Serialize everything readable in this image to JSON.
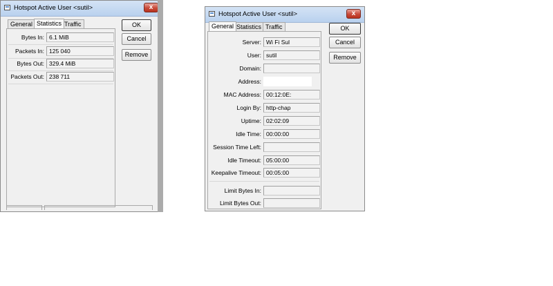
{
  "window_stats": {
    "title": "Hotspot Active User <sutil>",
    "close_label": "x",
    "tabs": [
      {
        "label": "General",
        "active": false
      },
      {
        "label": "Statistics",
        "active": true
      },
      {
        "label": "Traffic",
        "active": false
      }
    ],
    "fields": [
      {
        "label": "Bytes In:",
        "value": "6.1 MiB"
      },
      {
        "label": "Packets In:",
        "value": "125 040"
      },
      {
        "label": "Bytes Out:",
        "value": "329.4 MiB"
      },
      {
        "label": "Packets Out:",
        "value": "238 711"
      }
    ],
    "buttons": {
      "ok": "OK",
      "cancel": "Cancel",
      "remove": "Remove"
    }
  },
  "window_general": {
    "title": "Hotspot Active User <sutil>",
    "close_label": "x",
    "tabs": [
      {
        "label": "General",
        "active": true
      },
      {
        "label": "Statistics",
        "active": false
      },
      {
        "label": "Traffic",
        "active": false
      }
    ],
    "fields": [
      {
        "label": "Server:",
        "value": "Wi Fi Sul"
      },
      {
        "label": "User:",
        "value": "sutil"
      },
      {
        "label": "Domain:",
        "value": ""
      },
      {
        "label": "Address:",
        "value": ""
      },
      {
        "label": "MAC Address:",
        "value": "00:12:0E:"
      },
      {
        "label": "Login By:",
        "value": "http-chap"
      },
      {
        "label": "Uptime:",
        "value": "02:02:09"
      },
      {
        "label": "Idle Time:",
        "value": "00:00:00"
      },
      {
        "label": "Session Time Left:",
        "value": ""
      },
      {
        "label": "Idle Timeout:",
        "value": "05:00:00"
      },
      {
        "label": "Keepalive Timeout:",
        "value": "00:05:00"
      },
      {
        "label": "Limit Bytes In:",
        "value": ""
      },
      {
        "label": "Limit Bytes Out:",
        "value": ""
      }
    ],
    "buttons": {
      "ok": "OK",
      "cancel": "Cancel",
      "remove": "Remove"
    }
  }
}
